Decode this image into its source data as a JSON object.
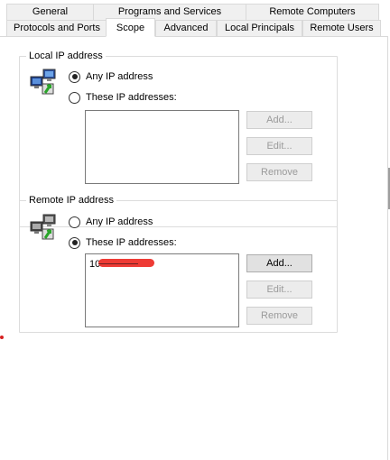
{
  "tabs_row1": [
    {
      "label": "General"
    },
    {
      "label": "Programs and Services"
    },
    {
      "label": "Remote Computers"
    }
  ],
  "tabs_row2": [
    {
      "label": "Protocols and Ports"
    },
    {
      "label": "Scope",
      "active": true
    },
    {
      "label": "Advanced"
    },
    {
      "label": "Local Principals"
    },
    {
      "label": "Remote Users"
    }
  ],
  "local": {
    "title": "Local IP address",
    "option_any": "Any IP address",
    "option_these": "These IP addresses:",
    "selected": "any",
    "entries": [],
    "buttons": {
      "add": "Add...",
      "edit": "Edit...",
      "remove": "Remove"
    }
  },
  "remote": {
    "title": "Remote IP address",
    "option_any": "Any IP address",
    "option_these": "These IP addresses:",
    "selected": "these",
    "entries": [
      "10"
    ],
    "buttons": {
      "add": "Add...",
      "edit": "Edit...",
      "remove": "Remove"
    }
  },
  "icons": {
    "network": "network-computers-icon"
  }
}
